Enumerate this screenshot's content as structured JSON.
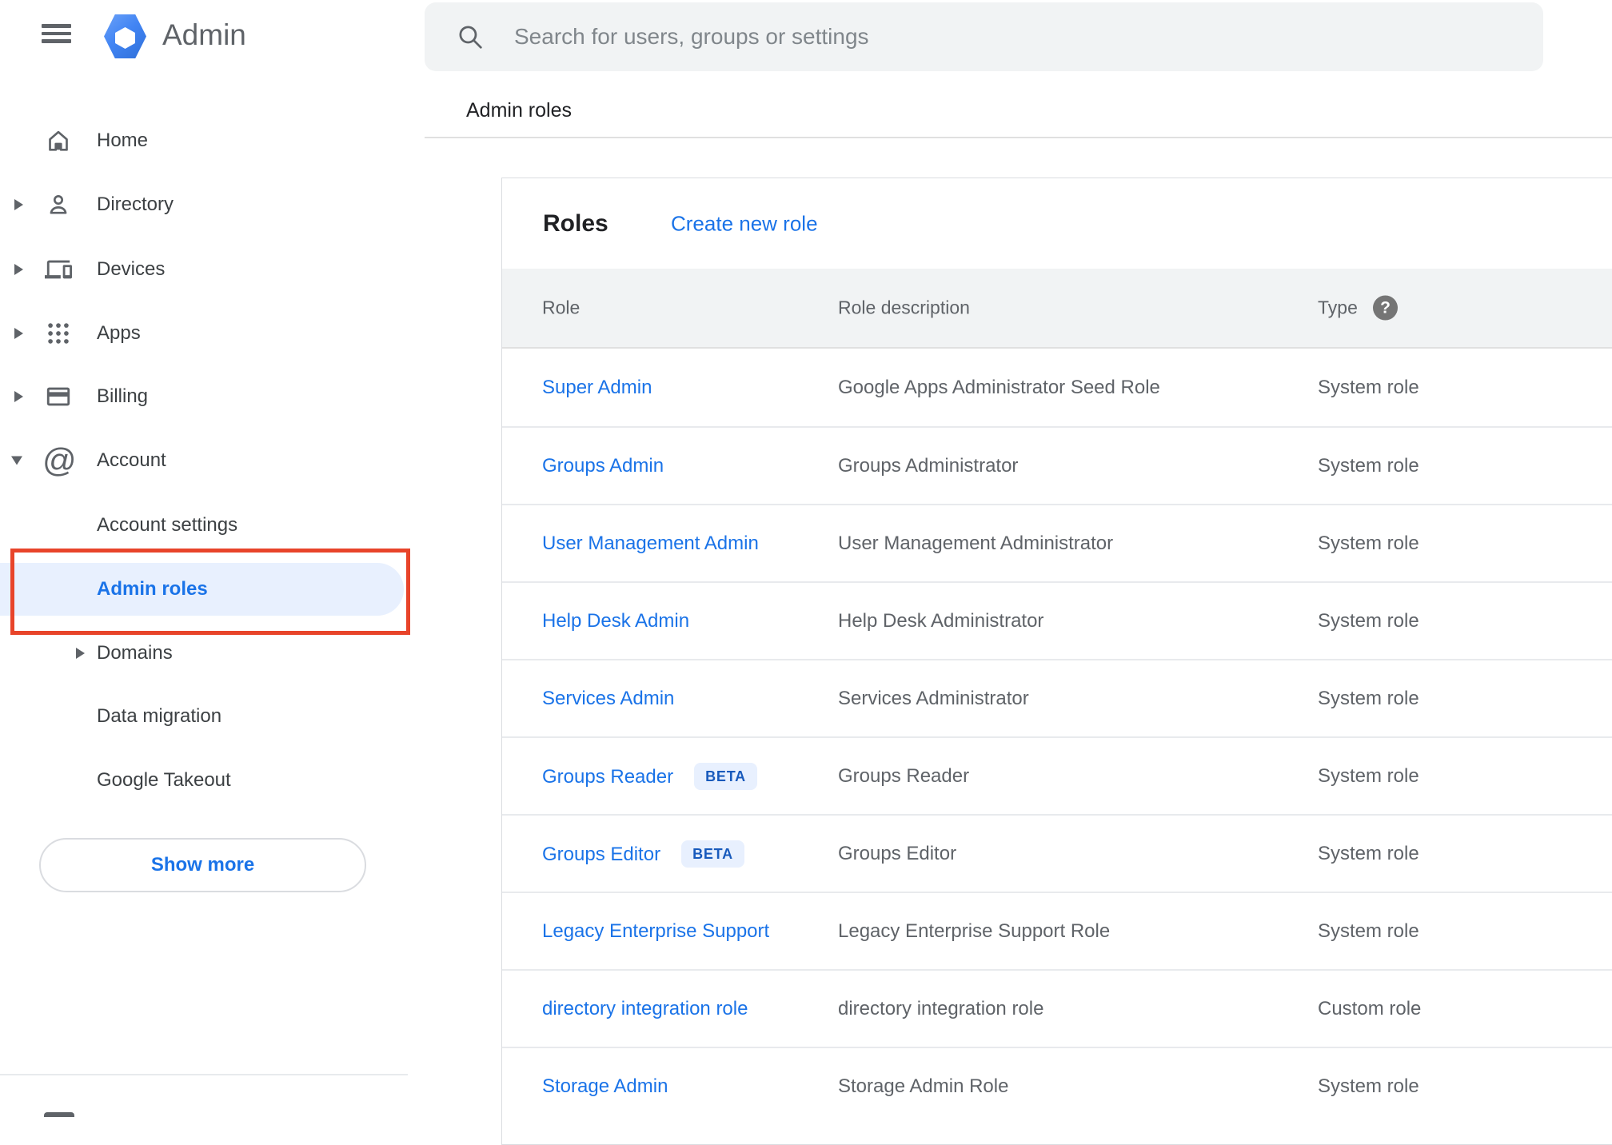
{
  "header": {
    "app_title": "Admin"
  },
  "search": {
    "placeholder": "Search for users, groups or settings"
  },
  "breadcrumb": {
    "label": "Admin roles"
  },
  "sidebar": {
    "items": [
      {
        "label": "Home"
      },
      {
        "label": "Directory"
      },
      {
        "label": "Devices"
      },
      {
        "label": "Apps"
      },
      {
        "label": "Billing"
      },
      {
        "label": "Account"
      },
      {
        "label": "Account settings"
      },
      {
        "label": "Admin roles"
      },
      {
        "label": "Domains"
      },
      {
        "label": "Data migration"
      },
      {
        "label": "Google Takeout"
      }
    ],
    "show_more_label": "Show more"
  },
  "roles_panel": {
    "title": "Roles",
    "create_link": "Create new role",
    "columns": {
      "role": "Role",
      "description": "Role description",
      "type": "Type"
    },
    "help_glyph": "?",
    "beta_label": "BETA",
    "rows": [
      {
        "role": "Super Admin",
        "description": "Google Apps Administrator Seed Role",
        "type": "System role"
      },
      {
        "role": "Groups Admin",
        "description": "Groups Administrator",
        "type": "System role"
      },
      {
        "role": "User Management Admin",
        "description": "User Management Administrator",
        "type": "System role"
      },
      {
        "role": "Help Desk Admin",
        "description": "Help Desk Administrator",
        "type": "System role"
      },
      {
        "role": "Services Admin",
        "description": "Services Administrator",
        "type": "System role"
      },
      {
        "role": "Groups Reader",
        "description": "Groups Reader",
        "type": "System role"
      },
      {
        "role": "Groups Editor",
        "description": "Groups Editor",
        "type": "System role"
      },
      {
        "role": "Legacy Enterprise Support",
        "description": "Legacy Enterprise Support Role",
        "type": "System role"
      },
      {
        "role": "directory integration role",
        "description": "directory integration role",
        "type": "Custom role"
      },
      {
        "role": "Storage Admin",
        "description": "Storage Admin Role",
        "type": "System role"
      }
    ]
  },
  "colors": {
    "accent": "#1a73e8",
    "highlight_bg": "#e8f0fe",
    "annotation_red": "#e8442a",
    "band_bg": "#f1f3f4"
  }
}
